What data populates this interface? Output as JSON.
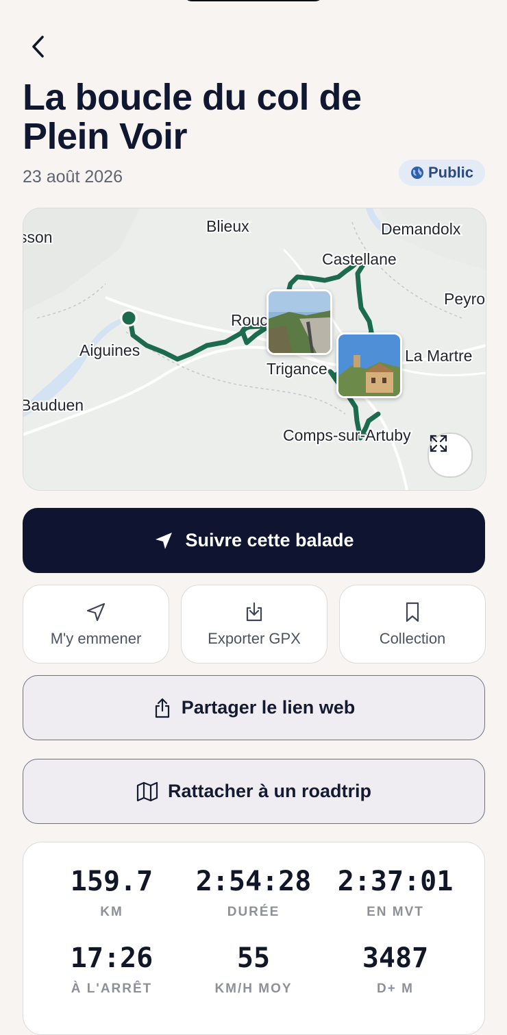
{
  "header": {
    "title": "La boucle du col de Plein Voir",
    "date": "23 août 2026",
    "visibility": "Public"
  },
  "map": {
    "places": [
      {
        "name": "sson"
      },
      {
        "name": "Blieux"
      },
      {
        "name": "Demandolx"
      },
      {
        "name": "Castellane"
      },
      {
        "name": "Peyro"
      },
      {
        "name": "Aiguines"
      },
      {
        "name": "Rouc"
      },
      {
        "name": "Trigance"
      },
      {
        "name": "La Martre"
      },
      {
        "name": "Bauduen"
      },
      {
        "name": "Comps-sur-Artuby"
      }
    ],
    "route_color": "#1d6b4e"
  },
  "actions": {
    "follow_label": "Suivre cette balade",
    "take_me_label": "M'y emmener",
    "export_label": "Exporter GPX",
    "collection_label": "Collection",
    "share_label": "Partager le lien web",
    "roadtrip_label": "Rattacher à un roadtrip"
  },
  "stats": [
    {
      "value": "159.7",
      "label": "KM"
    },
    {
      "value": "2:54:28",
      "label": "DURÉE"
    },
    {
      "value": "2:37:01",
      "label": "EN MVT"
    },
    {
      "value": "17:26",
      "label": "À L'ARRÊT"
    },
    {
      "value": "55",
      "label": "KM/H MOY"
    },
    {
      "value": "3487",
      "label": "D+ M"
    }
  ]
}
